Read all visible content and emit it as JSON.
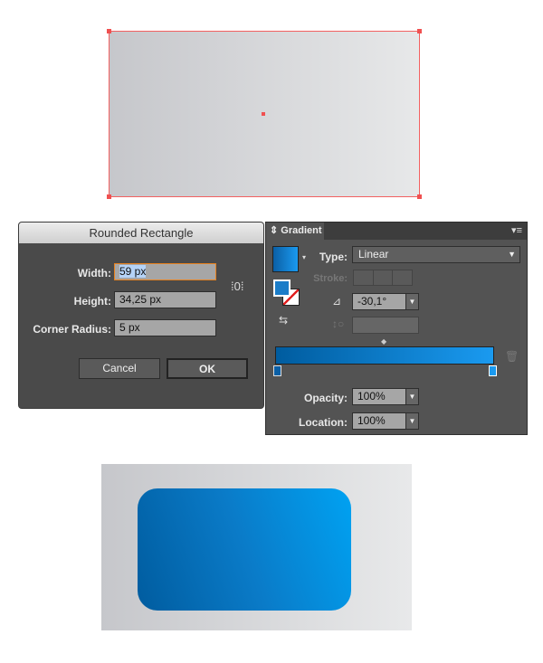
{
  "dialog": {
    "title": "Rounded Rectangle",
    "width_label": "Width:",
    "width_value": "59 px",
    "height_label": "Height:",
    "height_value": "34,25 px",
    "radius_label": "Corner Radius:",
    "radius_value": "5 px",
    "cancel": "Cancel",
    "ok": "OK"
  },
  "gradient_panel": {
    "tab": "Gradient",
    "type_label": "Type:",
    "type_value": "Linear",
    "stroke_label": "Stroke:",
    "angle_value": "-30,1°",
    "opacity_label": "Opacity:",
    "opacity_value": "100%",
    "location_label": "Location:",
    "location_value": "100%"
  },
  "colors": {
    "gradient_start": "#005c9f",
    "gradient_end": "#00a2f2",
    "selection": "#f05050"
  }
}
